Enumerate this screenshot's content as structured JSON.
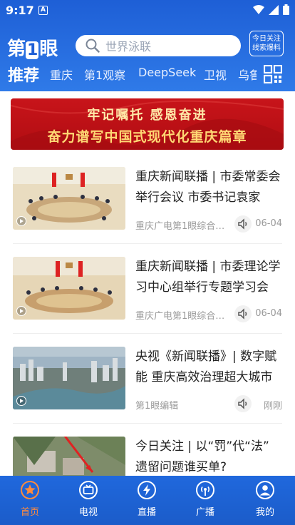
{
  "status": {
    "time": "9:17",
    "notif": "A"
  },
  "header": {
    "logo_text_a": "第",
    "logo_text_b": "1",
    "logo_text_c": "眼",
    "search_placeholder": "世界泳联",
    "focus_line1": "今日关注",
    "focus_line2": "线索爆料"
  },
  "tabs": [
    "推荐",
    "重庆",
    "第1观察",
    "DeepSeek",
    "卫视",
    "乌鲁"
  ],
  "banner": {
    "line1": "牢记嘱托  感恩奋进",
    "line2": "奋力谱写中国式现代化重庆篇章"
  },
  "news": [
    {
      "title": "重庆新闻联播 | 市委常委会举行会议 市委书记袁家军…",
      "source": "重庆广电第1眼综合…",
      "date": "06-04",
      "thumb": "meeting"
    },
    {
      "title": "重庆新闻联播 | 市委理论学习中心组举行专题学习会 …",
      "source": "重庆广电第1眼综合…",
      "date": "06-04",
      "thumb": "meeting"
    },
    {
      "title": "央视《新闻联播》| 数字赋能 重庆高效治理超大城市",
      "source": "第1眼编辑",
      "date": "刚刚",
      "thumb": "city"
    },
    {
      "title": "今日关注 | 以“罚”代“法” 遗留问题谁买单?",
      "source": "",
      "date": "",
      "thumb": "aerial"
    }
  ],
  "bottom_nav": [
    {
      "label": "首页",
      "icon": "home-star-icon",
      "active": true
    },
    {
      "label": "电视",
      "icon": "tv-icon",
      "active": false
    },
    {
      "label": "直播",
      "icon": "lightning-icon",
      "active": false
    },
    {
      "label": "广播",
      "icon": "radio-icon",
      "active": false
    },
    {
      "label": "我的",
      "icon": "user-icon",
      "active": false
    }
  ],
  "colors": {
    "brand_blue": "#1e5fd6",
    "active_orange": "#ff8b3d",
    "banner_red": "#c8141a"
  }
}
